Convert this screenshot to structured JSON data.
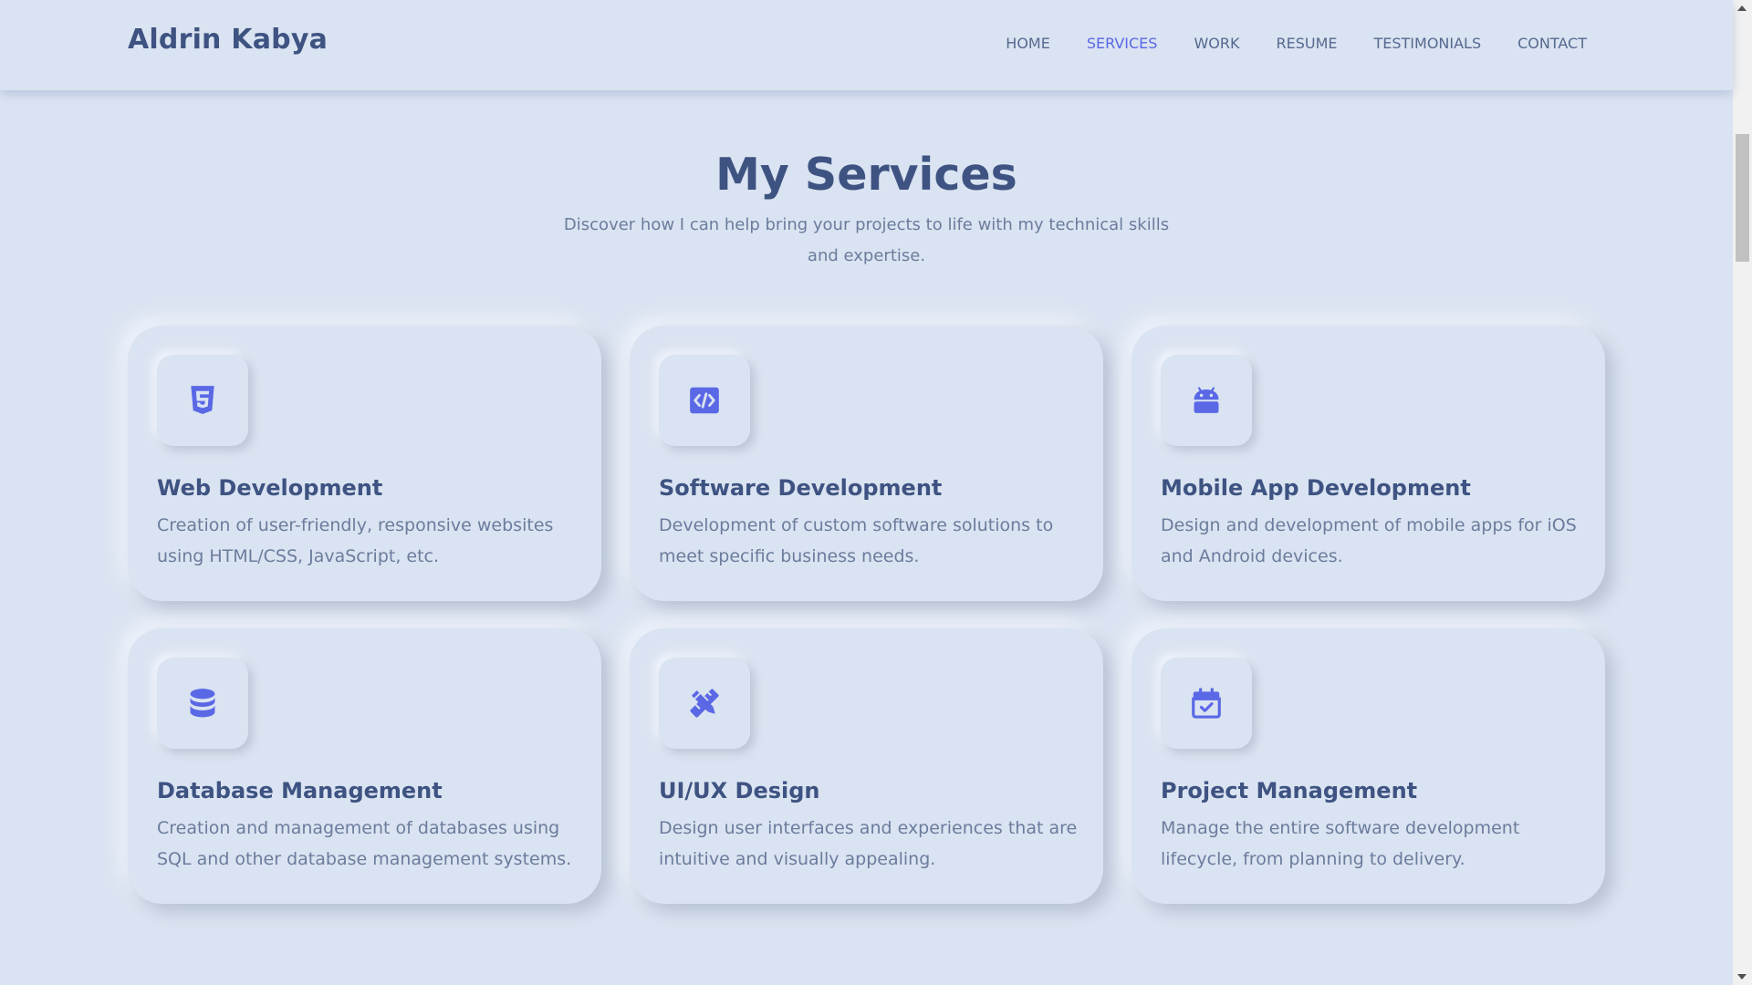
{
  "brand": {
    "name": "Aldrin Kabya"
  },
  "nav": {
    "items": [
      {
        "label": "HOME"
      },
      {
        "label": "SERVICES",
        "active": true
      },
      {
        "label": "WORK"
      },
      {
        "label": "RESUME"
      },
      {
        "label": "TESTIMONIALS"
      },
      {
        "label": "CONTACT"
      }
    ]
  },
  "services": {
    "title": "My Services",
    "subtitle": "Discover how I can help bring your projects to life with my technical skills and expertise.",
    "cards": [
      {
        "icon": "html5-icon",
        "title": "Web Development",
        "description": "Creation of user-friendly, responsive websites using HTML/CSS, JavaScript, etc."
      },
      {
        "icon": "code-icon",
        "title": "Software Development",
        "description": "Development of custom software solutions to meet specific business needs."
      },
      {
        "icon": "android-icon",
        "title": "Mobile App Development",
        "description": "Design and development of mobile apps for iOS and Android devices."
      },
      {
        "icon": "database-icon",
        "title": "Database Management",
        "description": "Creation and management of databases using SQL and other database management systems."
      },
      {
        "icon": "pencil-ruler-icon",
        "title": "UI/UX Design",
        "description": "Design user interfaces and experiences that are intuitive and visually appealing."
      },
      {
        "icon": "calendar-check-icon",
        "title": "Project Management",
        "description": "Manage the entire software development lifecycle, from planning to delivery."
      }
    ]
  },
  "colors": {
    "background": "#dae3f1",
    "heading": "#3e5382",
    "text": "#6b7c9d",
    "accent": "#5a68e6"
  }
}
